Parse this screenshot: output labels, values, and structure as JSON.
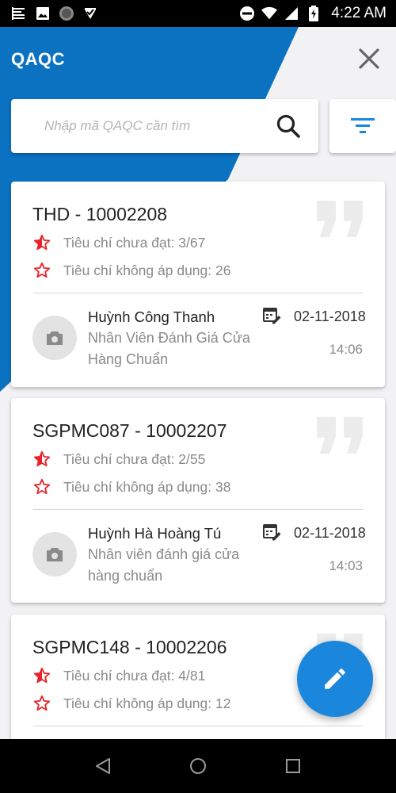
{
  "status_bar": {
    "time": "4:22 AM",
    "icons": [
      "menu-notification-icon",
      "image-notification-icon",
      "record-notification-icon",
      "tick-notification-icon",
      "dnd-icon",
      "wifi-icon",
      "signal-icon",
      "battery-charging-icon"
    ]
  },
  "app": {
    "title": "QAQC",
    "accent_color": "#0b72c2"
  },
  "search": {
    "placeholder": "Nhập mã QAQC cần tìm",
    "value": ""
  },
  "cards": [
    {
      "code": "THD - 10002208",
      "criteria_failed": "Tiêu chí chưa đạt: 3/67",
      "criteria_na": "Tiêu chí không áp dụng: 26",
      "user_name": "Huỳnh Công Thanh",
      "user_role": "Nhân Viên Đánh Giá Cửa Hàng Chuẩn",
      "date": "02-11-2018",
      "time": "14:06"
    },
    {
      "code": "SGPMC087 - 10002207",
      "criteria_failed": "Tiêu chí chưa đạt: 2/55",
      "criteria_na": "Tiêu chí không áp dụng: 38",
      "user_name": "Huỳnh Hà Hoàng Tú",
      "user_role": "Nhân viên đánh giá cửa hàng chuẩn",
      "date": "02-11-2018",
      "time": "14:03"
    },
    {
      "code": "SGPMC148 - 10002206",
      "criteria_failed": "Tiêu chí chưa đạt: 4/81",
      "criteria_na": "Tiêu chí không áp dụng: 12"
    }
  ],
  "colors": {
    "star": "#e8232a",
    "fab": "#1a86dc"
  }
}
